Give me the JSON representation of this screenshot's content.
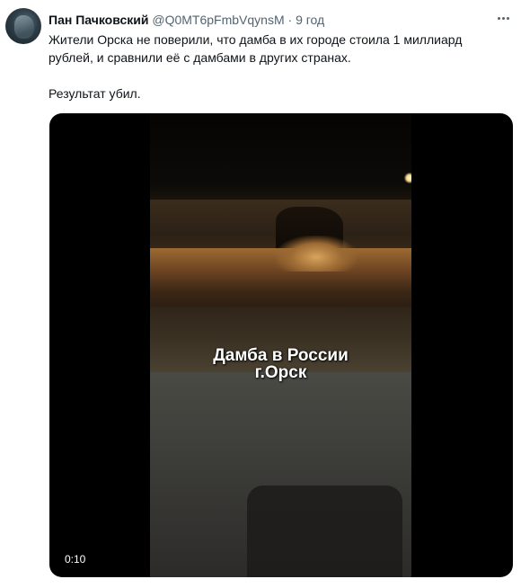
{
  "tweet": {
    "author_name": "Пан Пачковский",
    "author_handle": "@Q0MT6pFmbVqynsM",
    "separator": "·",
    "time": "9 год",
    "text_line1": "Жители Орска не поверили, что дамба в их городе стоила 1 миллиард рублей, и сравнили её с дамбами в других странах.",
    "text_line2": "Результат убил."
  },
  "media": {
    "caption_line1": "Дамба в России",
    "caption_line2": "г.Орск",
    "duration": "0:10"
  },
  "icons": {
    "more": "more-horizontal-icon"
  }
}
